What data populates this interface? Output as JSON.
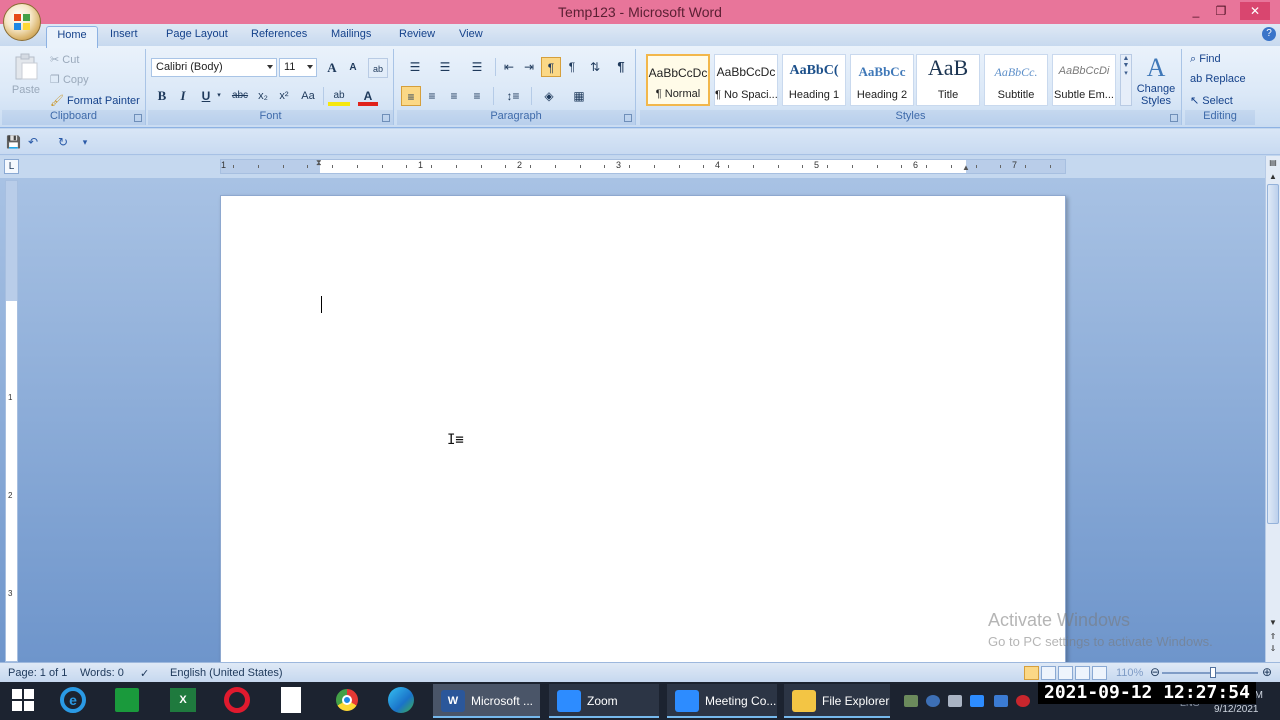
{
  "window": {
    "title": "Temp123 - Microsoft Word",
    "min": "_",
    "max": "❐",
    "close": "✕"
  },
  "tabs": [
    "Home",
    "Insert",
    "Page Layout",
    "References",
    "Mailings",
    "Review",
    "View"
  ],
  "clipboard": {
    "paste": "Paste",
    "cut": "Cut",
    "copy": "Copy",
    "format_painter": "Format Painter",
    "label": "Clipboard"
  },
  "font": {
    "family": "Calibri (Body)",
    "size": "11",
    "grow": "A",
    "shrink": "A",
    "bold": "B",
    "italic": "I",
    "underline": "U",
    "strike": "abc",
    "subscript": "x₂",
    "superscript": "x²",
    "change_case": "Aa",
    "highlight": "ab",
    "font_color": "A",
    "label": "Font"
  },
  "paragraph": {
    "show_marks": "¶",
    "label": "Paragraph"
  },
  "styles": {
    "items": [
      {
        "sample": "AaBbCcDc",
        "name": "¶ Normal"
      },
      {
        "sample": "AaBbCcDc",
        "name": "¶ No Spaci..."
      },
      {
        "sample": "AaBbC(",
        "name": "Heading 1"
      },
      {
        "sample": "AaBbCc",
        "name": "Heading 2"
      },
      {
        "sample": "AaB",
        "name": "Title"
      },
      {
        "sample": "AaBbCc.",
        "name": "Subtitle"
      },
      {
        "sample": "AaBbCcDi",
        "name": "Subtle Em..."
      }
    ],
    "change_styles_1": "Change",
    "change_styles_2": "Styles",
    "label": "Styles"
  },
  "editing": {
    "find": "Find",
    "replace": "Replace",
    "select": "Select",
    "label": "Editing"
  },
  "ruler": {
    "numbers": [
      "1",
      "1",
      "2",
      "3",
      "4",
      "5",
      "6",
      "7"
    ]
  },
  "vruler": {
    "numbers": [
      "1",
      "2",
      "3"
    ]
  },
  "watermark": {
    "line1": "Activate Windows",
    "line2": "Go to PC settings to activate Windows."
  },
  "status": {
    "page": "Page: 1 of 1",
    "words": "Words: 0",
    "language": "English (United States)",
    "zoom": "110%"
  },
  "taskbar": {
    "word": "Microsoft ...",
    "zoom": "Zoom",
    "meeting": "Meeting Co...",
    "explorer": "File Explorer",
    "clock": "2021-09-12  12:27:54",
    "date": "9/12/2021",
    "lang": "ENG",
    "ampm": "PM"
  },
  "colors": {
    "titlebar": "#e8759a",
    "ribbon": "#dbe8f7",
    "accent": "#15428b",
    "taskbar": "#1c2330"
  }
}
